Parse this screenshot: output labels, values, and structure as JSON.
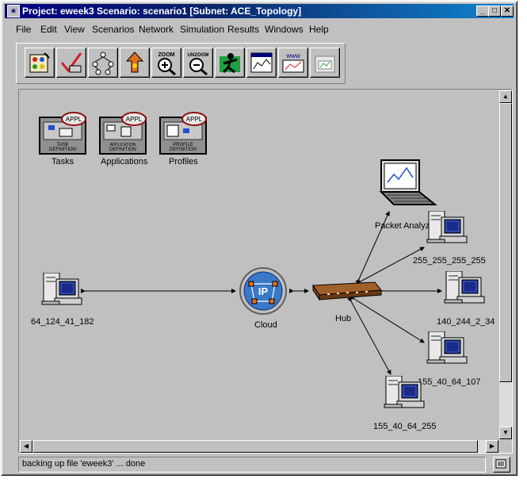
{
  "window": {
    "title": "Project: eweek3 Scenario: scenario1  [Subnet: ACE_Topology]",
    "min_glyph": "_",
    "max_glyph": "□",
    "close_glyph": "✕"
  },
  "menu": [
    {
      "label": "File"
    },
    {
      "label": "Edit"
    },
    {
      "label": "View"
    },
    {
      "label": "Scenarios"
    },
    {
      "label": "Network"
    },
    {
      "label": "Simulation"
    },
    {
      "label": "Results"
    },
    {
      "label": "Windows"
    },
    {
      "label": "Help"
    }
  ],
  "toolbar": {
    "buttons": [
      {
        "icon": "object-palette-icon"
      },
      {
        "icon": "check-links-icon"
      },
      {
        "icon": "fail-recover-icon"
      },
      {
        "icon": "return-parent-icon"
      },
      {
        "icon": "zoom-in-icon",
        "text": "ZOOM"
      },
      {
        "icon": "unzoom-icon",
        "text": "UNZOOM"
      },
      {
        "icon": "run-simulation-icon"
      },
      {
        "icon": "view-results-icon"
      },
      {
        "icon": "web-report-icon"
      },
      {
        "icon": "hide-graphs-icon"
      }
    ]
  },
  "config_nodes": [
    {
      "label": "Tasks",
      "badge": "APPL",
      "caption1": "TASK",
      "caption2": "DEFINITION"
    },
    {
      "label": "Applications",
      "badge": "APPL",
      "caption1": "APPLICATION",
      "caption2": "DEFINITION"
    },
    {
      "label": "Profiles",
      "badge": "APPL",
      "caption1": "PROFILE",
      "caption2": "DEFINITION"
    }
  ],
  "network": {
    "cloud": {
      "label": "Cloud",
      "badge": "IP"
    },
    "hub": {
      "label": "Hub"
    },
    "analyzer": {
      "label": "Packet Analyzer"
    },
    "hosts": [
      {
        "label": "64_124_41_182"
      },
      {
        "label": "255_255_255_255"
      },
      {
        "label": "140_244_2_34"
      },
      {
        "label": "155_40_64_107"
      },
      {
        "label": "155_40_64_255"
      }
    ]
  },
  "status": {
    "text": "backing up file 'eweek3' ... done"
  },
  "colors": {
    "title_start": "#000080",
    "title_end": "#1084d0",
    "canvas": "#c0c0c0",
    "cloud": "#3a78c8",
    "hub": "#8b4a1e"
  }
}
